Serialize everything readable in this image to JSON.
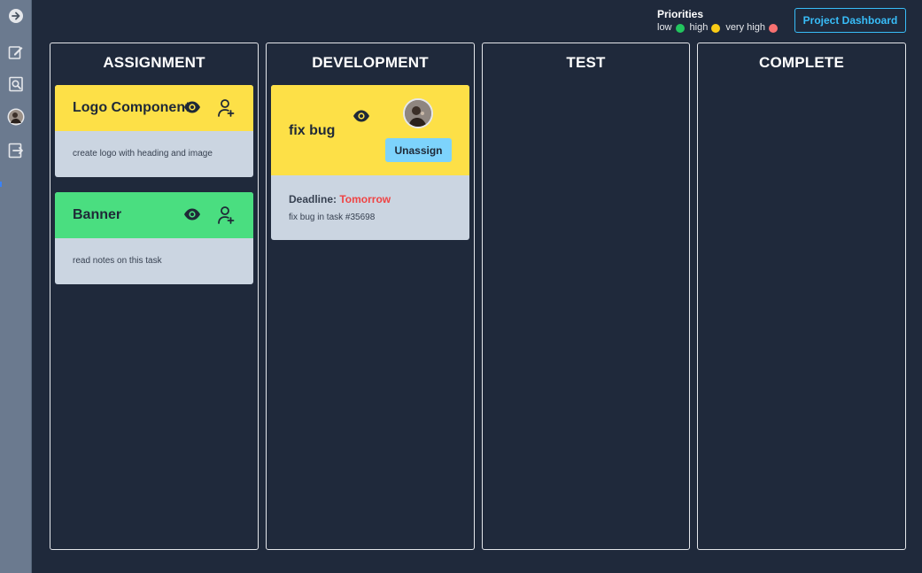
{
  "colors": {
    "background": "#1f293b",
    "sidebar": "#6b7a8f",
    "accent": "#38bdf8",
    "priority_low": "#22c55e",
    "priority_high": "#facc15",
    "priority_very_high": "#f87171",
    "card_yellow": "#fde047",
    "card_green": "#4ade80",
    "card_body": "#cbd5e1",
    "deadline_red": "#ef4444",
    "unassign_button": "#7dd3fc"
  },
  "sidebar": {
    "items": [
      {
        "icon": "arrow-right-circle-icon"
      },
      {
        "icon": "edit-icon"
      },
      {
        "icon": "search-document-icon"
      },
      {
        "icon": "user-avatar"
      },
      {
        "icon": "logout-icon"
      }
    ]
  },
  "header": {
    "priorities": {
      "title": "Priorities",
      "levels": [
        {
          "label": "low",
          "color": "#22c55e"
        },
        {
          "label": "high",
          "color": "#facc15"
        },
        {
          "label": "very high",
          "color": "#f87171"
        }
      ]
    },
    "dashboard_button": "Project Dashboard"
  },
  "columns": [
    {
      "title": "ASSIGNMENT",
      "cards": [
        {
          "title": "Logo Component",
          "description": "create logo with heading and image",
          "priority_color": "#fde047"
        },
        {
          "title": "Banner",
          "description": "read notes on this task",
          "priority_color": "#4ade80"
        }
      ]
    },
    {
      "title": "DEVELOPMENT",
      "cards": [
        {
          "title": "fix bug",
          "button": "Unassign",
          "deadline_label": "Deadline:",
          "deadline_value": "Tomorrow",
          "description": "fix bug in task #35698",
          "priority_color": "#fde047"
        }
      ]
    },
    {
      "title": "TEST",
      "cards": []
    },
    {
      "title": "COMPLETE",
      "cards": []
    }
  ]
}
